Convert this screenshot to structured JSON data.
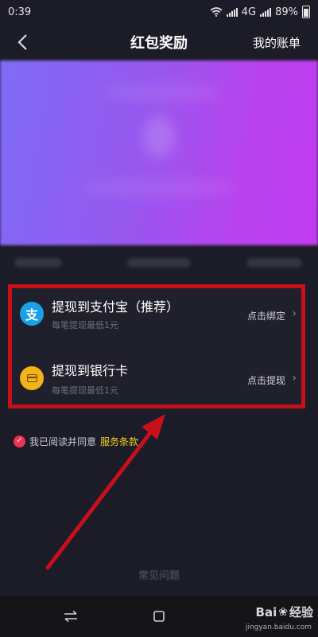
{
  "status_bar": {
    "time": "0:39",
    "network": "4G",
    "battery": "89%"
  },
  "nav": {
    "title": "红包奖励",
    "bill_label": "我的账单"
  },
  "withdraw_options": [
    {
      "title": "提现到支付宝（推荐）",
      "subtitle": "每笔提现最低1元",
      "action": "点击绑定",
      "icon": "alipay-icon"
    },
    {
      "title": "提现到银行卡",
      "subtitle": "每笔提现最低1元",
      "action": "点击提现",
      "icon": "bank-card-icon"
    }
  ],
  "alipay_glyph": "支",
  "agreement": {
    "text": "我已阅读并同意",
    "link": "服务条款",
    "checked": true
  },
  "faq_label": "常见问题",
  "watermark": {
    "brand": "Bai",
    "suffix": "经验",
    "url": "jingyan.baidu.com"
  },
  "colors": {
    "background": "#1b1c27",
    "highlight_box": "#c8101b",
    "annotation_arrow": "#c8101b",
    "alipay": "#1aa0e8",
    "bank_card": "#f2b416",
    "checkbox": "#f0334f",
    "terms_link": "#f4d222"
  }
}
